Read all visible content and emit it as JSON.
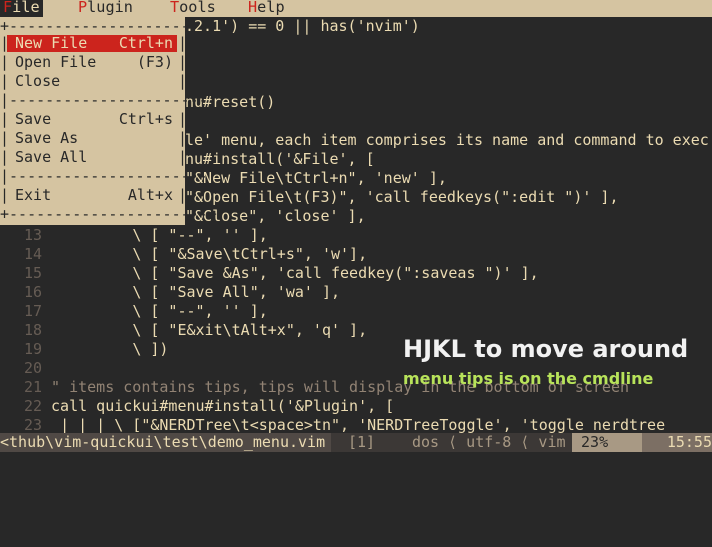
{
  "menubar": {
    "items": [
      "File",
      "Plugin",
      "Tools",
      "Help"
    ],
    "active": "File"
  },
  "file_menu": {
    "items": [
      {
        "label": "New File",
        "cmd": "Ctrl+n",
        "selected": true
      },
      {
        "label": "Open File",
        "cmd": "(F3)"
      },
      {
        "label": "Close",
        "cmd": ""
      },
      {
        "sep": true
      },
      {
        "label": "Save",
        "cmd": "Ctrl+s"
      },
      {
        "label": "Save As",
        "cmd": ""
      },
      {
        "label": "Save All",
        "cmd": ""
      },
      {
        "sep": true
      },
      {
        "label": "Exit",
        "cmd": "Alt+x"
      }
    ]
  },
  "editor": {
    "lines": [
      {
        "n": "",
        "text": ".2.1') == 0 || has('nvim')"
      },
      {
        "n": "",
        "text": ""
      },
      {
        "n": "",
        "text": ""
      },
      {
        "n": "",
        "text": ""
      },
      {
        "n": "",
        "text": "nu#reset()"
      },
      {
        "n": "",
        "text": ""
      },
      {
        "n": "",
        "text": "le' menu, each item comprises its name and command to exec"
      },
      {
        "n": "",
        "text": "nu#install('&File', ["
      },
      {
        "n": "",
        "text": "\"&New File\\tCtrl+n\", 'new' ],"
      },
      {
        "n": "",
        "text": "\"&Open File\\t(F3)\", 'call feedkeys(\":edit \")' ],"
      },
      {
        "n": "",
        "text": "\"&Close\", 'close' ],"
      },
      {
        "n": "13",
        "text": "\\ [ \"--\", '' ],"
      },
      {
        "n": "14",
        "text": "\\ [ \"&Save\\tCtrl+s\", 'w'],"
      },
      {
        "n": "15",
        "text": "\\ [ \"Save &As\", 'call feedkey(\":saveas \")' ],"
      },
      {
        "n": "16",
        "text": "\\ [ \"Save All\", 'wa' ],"
      },
      {
        "n": "17",
        "text": "\\ [ \"--\", '' ],"
      },
      {
        "n": "18",
        "text": "\\ [ \"E&xit\\tAlt+x\", 'q' ],"
      },
      {
        "n": "19",
        "text": "\\ ])"
      },
      {
        "n": "20",
        "text": ""
      },
      {
        "n": "21",
        "text": "\" items contains tips, tips will display in the bottom of screen"
      },
      {
        "n": "22",
        "text": "call quickui#menu#install('&Plugin', ["
      },
      {
        "n": "23",
        "text": "| | | \\ [\"&NERDTree\\t<space>tn\", 'NERDTreeToggle', 'toggle nerdtree"
      }
    ]
  },
  "overlay": {
    "title": "HJKL to move around",
    "subtitle": "menu tips is on the cmdline"
  },
  "statusline": {
    "file": "<thub\\vim-quickui\\test\\demo_menu.vim",
    "buffer": "[1]",
    "encoding": "dos ⟨ utf-8 ⟨ vim",
    "percent": "23%",
    "position": "15:55"
  },
  "colors": {
    "background": "#282828",
    "menu_bg": "#d5c4a1",
    "selection": "#cc241d",
    "overlay_sub": "#b8e35a"
  }
}
